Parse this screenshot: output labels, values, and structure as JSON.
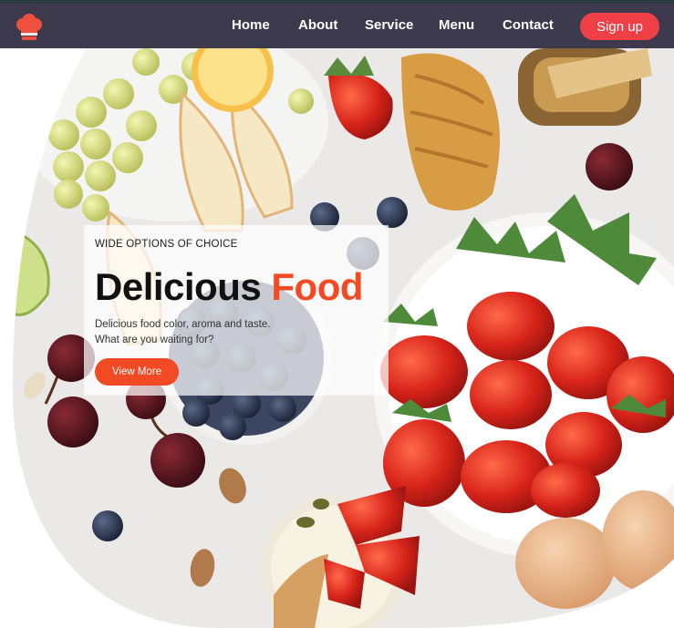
{
  "nav": {
    "links": [
      "Home",
      "About",
      "Service",
      "Menu",
      "Contact"
    ],
    "signup_label": "Sign up"
  },
  "hero": {
    "eyebrow": "WIDE OPTIONS OF CHOICE",
    "headline_main": "Delicious ",
    "headline_accent": "Food",
    "description_line1": "Delicious food color, aroma and taste.",
    "description_line2": "What are you waiting for?",
    "cta_label": "View More"
  },
  "colors": {
    "navbar_bg": "#3c3a4c",
    "accent": "#f24a24",
    "signup_bg": "#ef4048"
  },
  "icons": {
    "logo": "chef-hat-icon"
  }
}
